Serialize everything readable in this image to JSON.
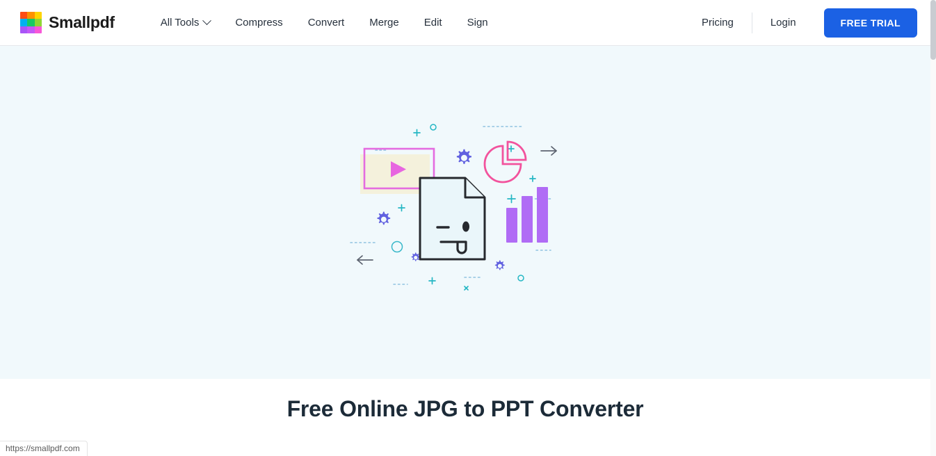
{
  "browser": {
    "status_bar_url": "https://smallpdf.com"
  },
  "header": {
    "brand_name": "Smallpdf",
    "logo_icon": "smallpdf-logo-icon",
    "logo_colors": [
      "#ff4d16",
      "#ff9100",
      "#ffd400",
      "#00b0f0",
      "#17c964",
      "#8fd633",
      "#a855f7",
      "#c459f7",
      "#f857d7"
    ],
    "nav_items": [
      {
        "label": "All Tools",
        "has_dropdown": true
      },
      {
        "label": "Compress",
        "has_dropdown": false
      },
      {
        "label": "Convert",
        "has_dropdown": false
      },
      {
        "label": "Merge",
        "has_dropdown": false
      },
      {
        "label": "Edit",
        "has_dropdown": false
      },
      {
        "label": "Sign",
        "has_dropdown": false
      }
    ],
    "pricing_label": "Pricing",
    "login_label": "Login",
    "cta_label": "FREE TRIAL",
    "cta_color": "#1b61e4"
  },
  "hero": {
    "background_color": "#f1f9fc",
    "illustration_name": "jpg-to-ppt-hero-illustration",
    "illustration_parts": {
      "document_face": "winking-document-icon",
      "video_frame": "video-play-frame",
      "pie_chart": "pie-chart-icon",
      "bar_chart": "bar-chart-icon",
      "gears": "gear-icon",
      "arrow_right": "arrow-right-icon",
      "arrow_left": "arrow-left-icon"
    },
    "colors": {
      "gear_purple": "#6161e0",
      "pie_pink": "#f2539d",
      "bar_purple": "#b06cf5",
      "video_frame_pink": "#e46ce0",
      "video_fill": "#f4f1dc",
      "doc_stroke": "#26292e",
      "doc_fill": "#eaf6fa",
      "accent_teal": "#25b7c4",
      "dash_blue": "#8fc2e0"
    }
  },
  "main": {
    "page_title": "Free Online JPG to PPT Converter",
    "subtitle_partial": ""
  }
}
